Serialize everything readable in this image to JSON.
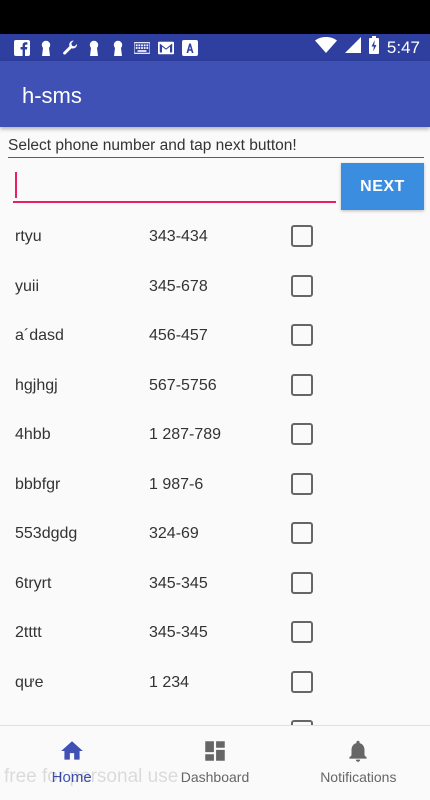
{
  "status_bar": {
    "time": "5:47",
    "left_icons": [
      "facebook-icon",
      "keyhole-icon",
      "wrench-icon",
      "keyhole-icon",
      "keyhole-icon",
      "keyboard-icon",
      "gmail-icon",
      "a-icon"
    ],
    "right_icons": [
      "wifi-icon",
      "signal-icon",
      "battery-charging-icon"
    ]
  },
  "app_bar": {
    "title": "h-sms"
  },
  "form": {
    "instruction": "Select phone number and tap next button!",
    "phone_value": "",
    "next_label": "NEXT"
  },
  "contacts": [
    {
      "name": "rtyu",
      "phone": "343-434",
      "checked": false
    },
    {
      "name": "yuii",
      "phone": "345-678",
      "checked": false
    },
    {
      "name": "a´dasd",
      "phone": "456-457",
      "checked": false
    },
    {
      "name": "hgjhgj",
      "phone": "567-5756",
      "checked": false
    },
    {
      "name": "4hbb",
      "phone": "1 287-789",
      "checked": false
    },
    {
      "name": "bbbfgr",
      "phone": "1 987-6",
      "checked": false
    },
    {
      "name": "553dgdg",
      "phone": "324-69",
      "checked": false
    },
    {
      "name": "6tryrt",
      "phone": "345-345",
      "checked": false
    },
    {
      "name": "2tttt",
      "phone": "345-345",
      "checked": false
    },
    {
      "name": "qưe",
      "phone": "1 234",
      "checked": false
    },
    {
      "name": "",
      "phone": "",
      "checked": false
    }
  ],
  "bottom_nav": {
    "items": [
      {
        "label": "Home",
        "icon": "home-icon",
        "active": true
      },
      {
        "label": "Dashboard",
        "icon": "dashboard-icon",
        "active": false
      },
      {
        "label": "Notifications",
        "icon": "bell-icon",
        "active": false
      }
    ]
  },
  "colors": {
    "status_bar": "#2f3fa0",
    "app_bar": "#3f51b5",
    "accent": "#e91e63",
    "next_button": "#3b8de0",
    "active_nav": "#3f51b5"
  },
  "watermark": "free for personal use"
}
